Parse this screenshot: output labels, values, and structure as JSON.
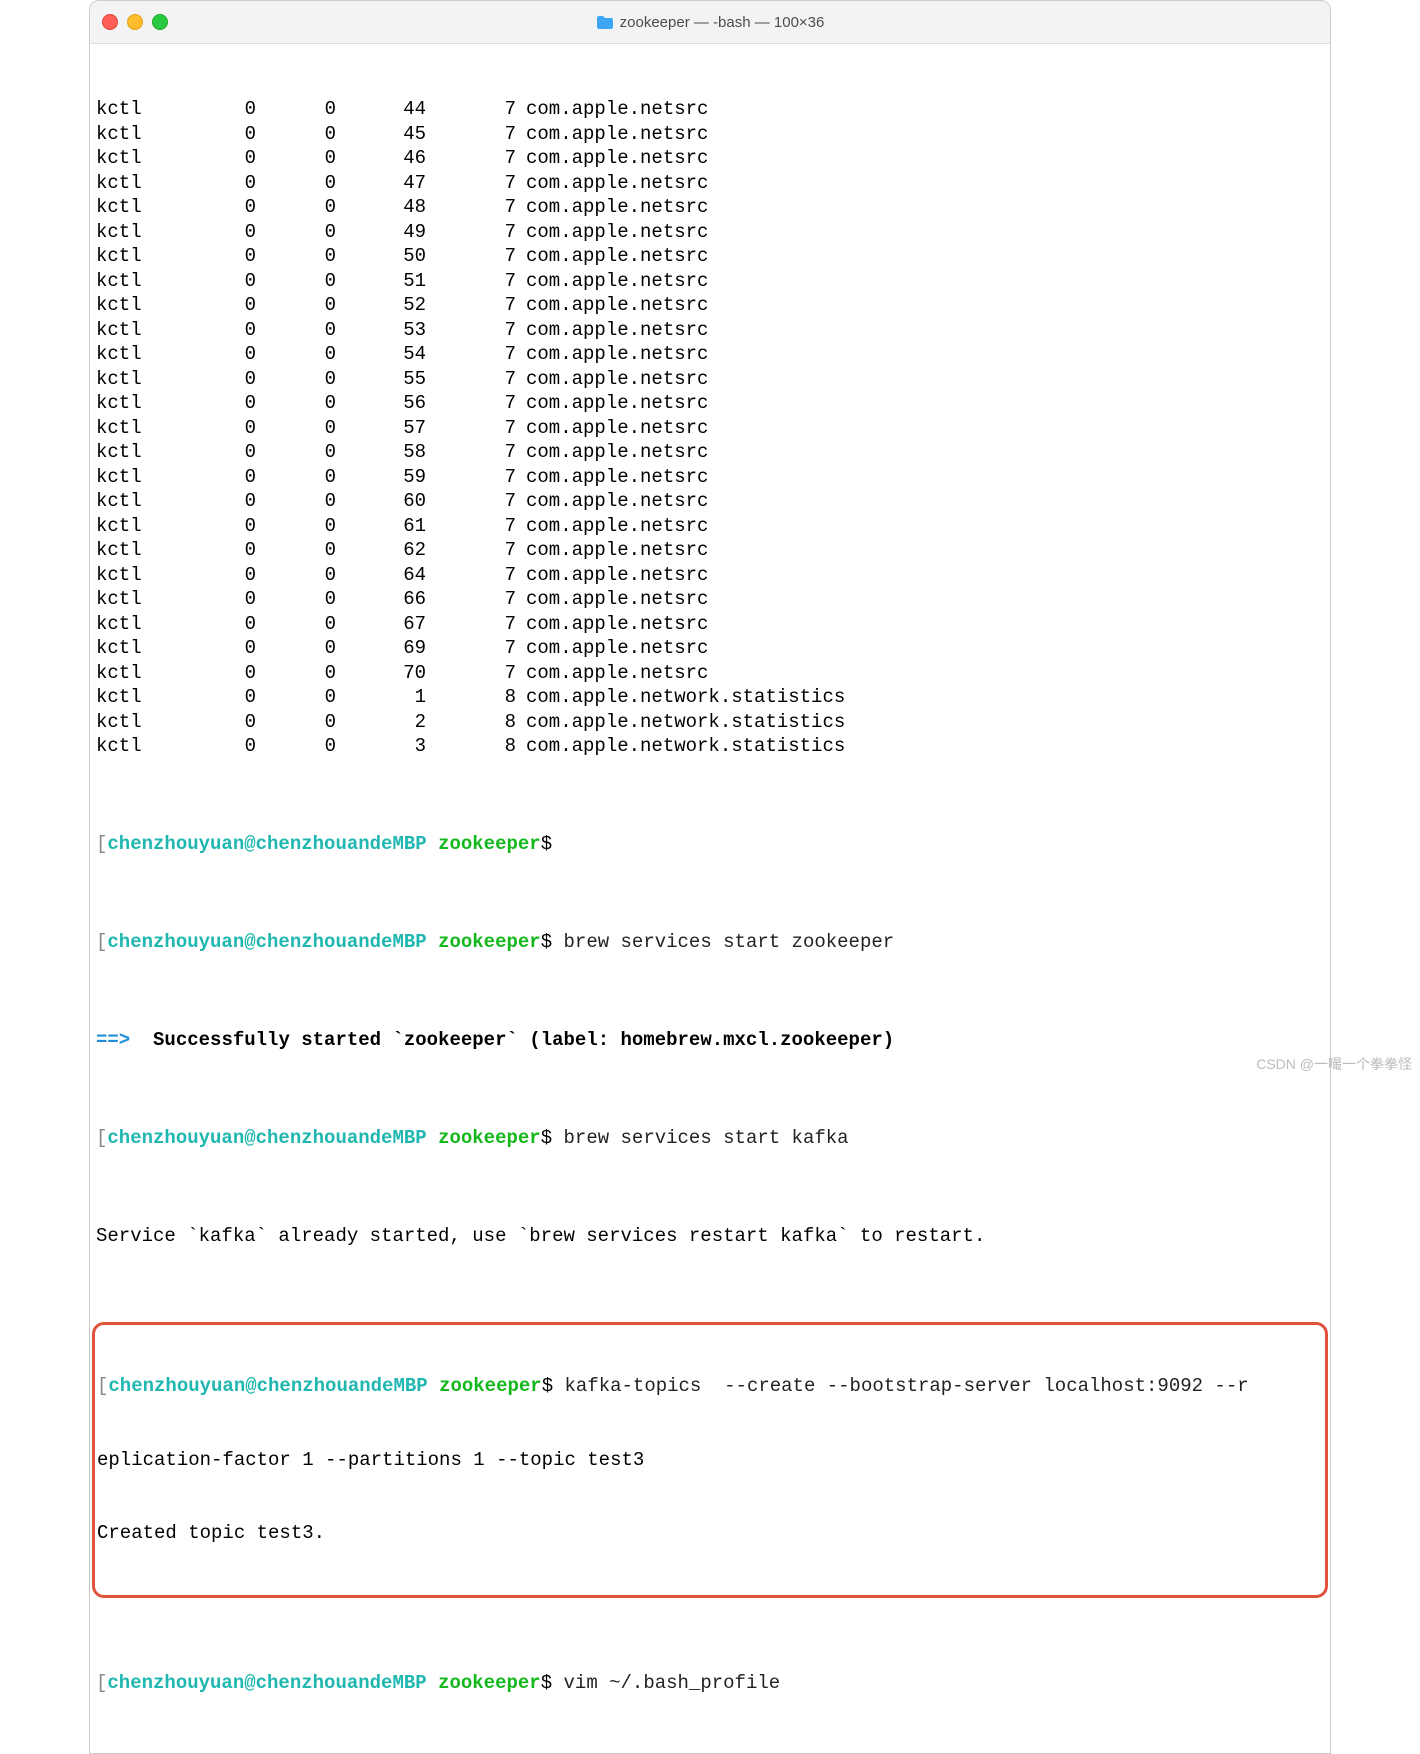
{
  "window": {
    "title": "zookeeper — -bash — 100×36"
  },
  "colors": {
    "prompt_user": "#1fb7b0",
    "prompt_dir": "#14b81d",
    "highlight": "#e2533c"
  },
  "prompt": {
    "user": "chenzhouyuan@chenzhouandeMBP",
    "dir": "zookeeper",
    "symbol": "$"
  },
  "netstat_rows": [
    {
      "p": "kctl",
      "a": "0",
      "b": "0",
      "c": "44",
      "d": "7",
      "name": "com.apple.netsrc"
    },
    {
      "p": "kctl",
      "a": "0",
      "b": "0",
      "c": "45",
      "d": "7",
      "name": "com.apple.netsrc"
    },
    {
      "p": "kctl",
      "a": "0",
      "b": "0",
      "c": "46",
      "d": "7",
      "name": "com.apple.netsrc"
    },
    {
      "p": "kctl",
      "a": "0",
      "b": "0",
      "c": "47",
      "d": "7",
      "name": "com.apple.netsrc"
    },
    {
      "p": "kctl",
      "a": "0",
      "b": "0",
      "c": "48",
      "d": "7",
      "name": "com.apple.netsrc"
    },
    {
      "p": "kctl",
      "a": "0",
      "b": "0",
      "c": "49",
      "d": "7",
      "name": "com.apple.netsrc"
    },
    {
      "p": "kctl",
      "a": "0",
      "b": "0",
      "c": "50",
      "d": "7",
      "name": "com.apple.netsrc"
    },
    {
      "p": "kctl",
      "a": "0",
      "b": "0",
      "c": "51",
      "d": "7",
      "name": "com.apple.netsrc"
    },
    {
      "p": "kctl",
      "a": "0",
      "b": "0",
      "c": "52",
      "d": "7",
      "name": "com.apple.netsrc"
    },
    {
      "p": "kctl",
      "a": "0",
      "b": "0",
      "c": "53",
      "d": "7",
      "name": "com.apple.netsrc"
    },
    {
      "p": "kctl",
      "a": "0",
      "b": "0",
      "c": "54",
      "d": "7",
      "name": "com.apple.netsrc"
    },
    {
      "p": "kctl",
      "a": "0",
      "b": "0",
      "c": "55",
      "d": "7",
      "name": "com.apple.netsrc"
    },
    {
      "p": "kctl",
      "a": "0",
      "b": "0",
      "c": "56",
      "d": "7",
      "name": "com.apple.netsrc"
    },
    {
      "p": "kctl",
      "a": "0",
      "b": "0",
      "c": "57",
      "d": "7",
      "name": "com.apple.netsrc"
    },
    {
      "p": "kctl",
      "a": "0",
      "b": "0",
      "c": "58",
      "d": "7",
      "name": "com.apple.netsrc"
    },
    {
      "p": "kctl",
      "a": "0",
      "b": "0",
      "c": "59",
      "d": "7",
      "name": "com.apple.netsrc"
    },
    {
      "p": "kctl",
      "a": "0",
      "b": "0",
      "c": "60",
      "d": "7",
      "name": "com.apple.netsrc"
    },
    {
      "p": "kctl",
      "a": "0",
      "b": "0",
      "c": "61",
      "d": "7",
      "name": "com.apple.netsrc"
    },
    {
      "p": "kctl",
      "a": "0",
      "b": "0",
      "c": "62",
      "d": "7",
      "name": "com.apple.netsrc"
    },
    {
      "p": "kctl",
      "a": "0",
      "b": "0",
      "c": "64",
      "d": "7",
      "name": "com.apple.netsrc"
    },
    {
      "p": "kctl",
      "a": "0",
      "b": "0",
      "c": "66",
      "d": "7",
      "name": "com.apple.netsrc"
    },
    {
      "p": "kctl",
      "a": "0",
      "b": "0",
      "c": "67",
      "d": "7",
      "name": "com.apple.netsrc"
    },
    {
      "p": "kctl",
      "a": "0",
      "b": "0",
      "c": "69",
      "d": "7",
      "name": "com.apple.netsrc"
    },
    {
      "p": "kctl",
      "a": "0",
      "b": "0",
      "c": "70",
      "d": "7",
      "name": "com.apple.netsrc"
    },
    {
      "p": "kctl",
      "a": "0",
      "b": "0",
      "c": "1",
      "d": "8",
      "name": "com.apple.network.statistics"
    },
    {
      "p": "kctl",
      "a": "0",
      "b": "0",
      "c": "2",
      "d": "8",
      "name": "com.apple.network.statistics"
    },
    {
      "p": "kctl",
      "a": "0",
      "b": "0",
      "c": "3",
      "d": "8",
      "name": "com.apple.network.statistics"
    }
  ],
  "lines": {
    "cmd_empty": "",
    "cmd_startzk": "brew services start zookeeper",
    "msg_arrow": "==>",
    "msg_success": "Successfully started `zookeeper` (label: homebrew.mxcl.zookeeper)",
    "cmd_startkafka": "brew services start kafka",
    "msg_already": "Service `kafka` already started, use `brew services restart kafka` to restart.",
    "cmd_kafka_a": "kafka-topics  --create --bootstrap-server localhost:9092 --r",
    "cmd_kafka_b": "eplication-factor 1 --partitions 1 --topic test3",
    "msg_created": "Created topic test3.",
    "cmd_vim": "vim ~/.bash_profile"
  },
  "watermark": "CSDN @一嘬一个拳拳怪"
}
